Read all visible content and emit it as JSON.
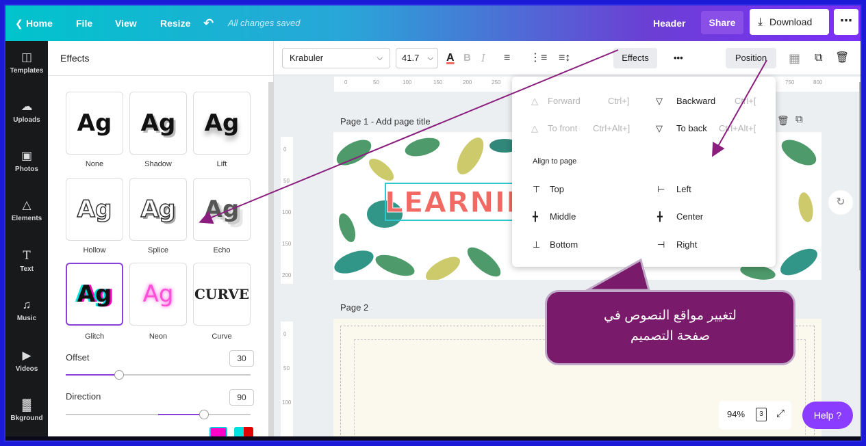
{
  "topbar": {
    "home": "Home",
    "file": "File",
    "view": "View",
    "resize": "Resize",
    "saved_status": "All changes saved",
    "header": "Header",
    "share": "Share",
    "download": "Download"
  },
  "leftnav": {
    "items": [
      {
        "label": "Templates",
        "icon": "templates-icon"
      },
      {
        "label": "Uploads",
        "icon": "upload-cloud-icon"
      },
      {
        "label": "Photos",
        "icon": "photo-icon"
      },
      {
        "label": "Elements",
        "icon": "shapes-icon"
      },
      {
        "label": "Text",
        "icon": "text-icon"
      },
      {
        "label": "Music",
        "icon": "music-note-icon"
      },
      {
        "label": "Videos",
        "icon": "video-icon"
      },
      {
        "label": "Bkground",
        "icon": "background-pattern-icon"
      }
    ]
  },
  "panel": {
    "title": "Effects",
    "effects": [
      {
        "label": "None",
        "sample": "Ag"
      },
      {
        "label": "Shadow",
        "sample": "Ag"
      },
      {
        "label": "Lift",
        "sample": "Ag"
      },
      {
        "label": "Hollow",
        "sample": "Ag"
      },
      {
        "label": "Splice",
        "sample": "Ag"
      },
      {
        "label": "Echo",
        "sample": "Ag"
      },
      {
        "label": "Glitch",
        "sample": "Ag"
      },
      {
        "label": "Neon",
        "sample": "Ag"
      },
      {
        "label": "Curve",
        "sample": "CURVE"
      }
    ],
    "offset": {
      "label": "Offset",
      "value": "30"
    },
    "direction": {
      "label": "Direction",
      "value": "90"
    }
  },
  "toolbar": {
    "font": "Krabuler",
    "font_size": "41.7",
    "text_color_glyph": "A",
    "bold_glyph": "B",
    "italic_glyph": "I",
    "effects": "Effects",
    "more": "•••",
    "position": "Position"
  },
  "ruler": {
    "ticks": [
      "0",
      "50",
      "100",
      "150",
      "200",
      "250",
      "750",
      "800"
    ]
  },
  "vruler1": {
    "ticks": [
      "0",
      "50",
      "100",
      "150",
      "200"
    ]
  },
  "vruler2": {
    "ticks": [
      "0",
      "50",
      "100"
    ]
  },
  "canvas": {
    "page1_title": "Page 1 - Add page title",
    "page2_title": "Page 2",
    "headline": "LEARNING I"
  },
  "position_menu": {
    "forward": "Forward",
    "forward_shortcut": "Ctrl+]",
    "backward": "Backward",
    "backward_shortcut": "Ctrl+[",
    "to_front": "To front",
    "to_front_shortcut": "Ctrl+Alt+]",
    "to_back": "To back",
    "to_back_shortcut": "Ctrl+Alt+[",
    "align_heading": "Align to page",
    "top": "Top",
    "left": "Left",
    "middle": "Middle",
    "center": "Center",
    "bottom": "Bottom",
    "right": "Right"
  },
  "zoom": {
    "level": "94%",
    "page_count": "3"
  },
  "help": "Help ?",
  "callout": {
    "line1": "لتغيير مواقع النصوص في",
    "line2": "صفحة التصميم"
  },
  "colors": {
    "accent": "#8b3dff",
    "callout": "#7a1a6b",
    "headline": "#f06a63",
    "arrow": "#8a1e7e"
  }
}
